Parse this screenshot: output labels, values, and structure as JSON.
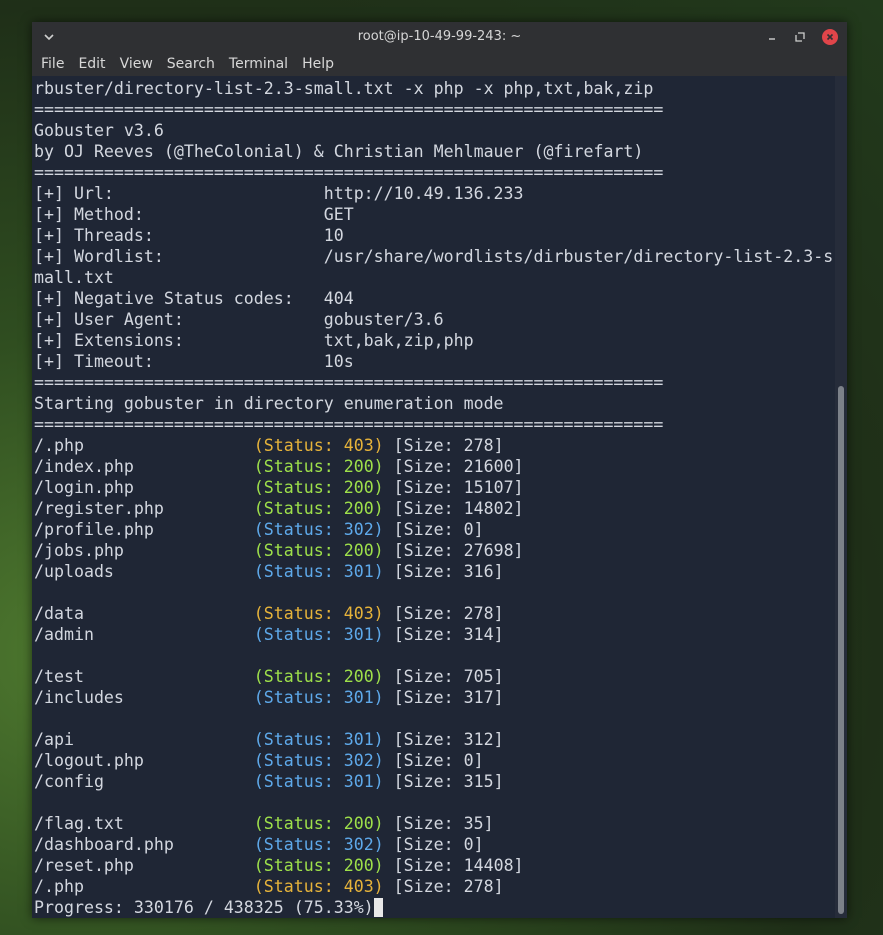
{
  "window": {
    "title": "root@ip-10-49-99-243: ~",
    "menu": [
      "File",
      "Edit",
      "View",
      "Search",
      "Terminal",
      "Help"
    ]
  },
  "terminal": {
    "header_lines": [
      "rbuster/directory-list-2.3-small.txt -x php -x php,txt,bak,zip",
      "===============================================================",
      "Gobuster v3.6",
      "by OJ Reeves (@TheColonial) & Christian Mehlmauer (@firefart)",
      "===============================================================",
      "[+] Url:                     http://10.49.136.233",
      "[+] Method:                  GET",
      "[+] Threads:                 10",
      "[+] Wordlist:                /usr/share/wordlists/dirbuster/directory-list-2.3-s",
      "mall.txt",
      "[+] Negative Status codes:   404",
      "[+] User Agent:              gobuster/3.6",
      "[+] Extensions:              txt,bak,zip,php",
      "[+] Timeout:                 10s",
      "===============================================================",
      "Starting gobuster in directory enumeration mode",
      "==============================================================="
    ],
    "results": [
      {
        "path": "/.php",
        "status": "(Status: 403)",
        "size": "[Size: 278]",
        "color": "yellow"
      },
      {
        "path": "/index.php",
        "status": "(Status: 200)",
        "size": "[Size: 21600]",
        "color": "green"
      },
      {
        "path": "/login.php",
        "status": "(Status: 200)",
        "size": "[Size: 15107]",
        "color": "green"
      },
      {
        "path": "/register.php",
        "status": "(Status: 200)",
        "size": "[Size: 14802]",
        "color": "green"
      },
      {
        "path": "/profile.php",
        "status": "(Status: 302)",
        "size": "[Size: 0]",
        "color": "blue"
      },
      {
        "path": "/jobs.php",
        "status": "(Status: 200)",
        "size": "[Size: 27698]",
        "color": "green"
      },
      {
        "path": "/uploads",
        "status": "(Status: 301)",
        "size": "[Size: 316]",
        "color": "blue"
      },
      {
        "blank": true
      },
      {
        "path": "/data",
        "status": "(Status: 403)",
        "size": "[Size: 278]",
        "color": "yellow"
      },
      {
        "path": "/admin",
        "status": "(Status: 301)",
        "size": "[Size: 314]",
        "color": "blue"
      },
      {
        "blank": true
      },
      {
        "path": "/test",
        "status": "(Status: 200)",
        "size": "[Size: 705]",
        "color": "green"
      },
      {
        "path": "/includes",
        "status": "(Status: 301)",
        "size": "[Size: 317]",
        "color": "blue"
      },
      {
        "blank": true
      },
      {
        "path": "/api",
        "status": "(Status: 301)",
        "size": "[Size: 312]",
        "color": "blue"
      },
      {
        "path": "/logout.php",
        "status": "(Status: 302)",
        "size": "[Size: 0]",
        "color": "blue"
      },
      {
        "path": "/config",
        "status": "(Status: 301)",
        "size": "[Size: 315]",
        "color": "blue"
      },
      {
        "blank": true
      },
      {
        "path": "/flag.txt",
        "status": "(Status: 200)",
        "size": "[Size: 35]",
        "color": "green"
      },
      {
        "path": "/dashboard.php",
        "status": "(Status: 302)",
        "size": "[Size: 0]",
        "color": "blue"
      },
      {
        "path": "/reset.php",
        "status": "(Status: 200)",
        "size": "[Size: 14408]",
        "color": "green"
      },
      {
        "path": "/.php",
        "status": "(Status: 403)",
        "size": "[Size: 278]",
        "color": "yellow"
      }
    ],
    "progress_line": "Progress: 330176 / 438325 (75.33%)"
  },
  "colors": {
    "terminal_bg": "#1f2635",
    "status_200": "#9ee04a",
    "status_30x": "#5ea9ea",
    "status_403": "#e6b33a"
  }
}
